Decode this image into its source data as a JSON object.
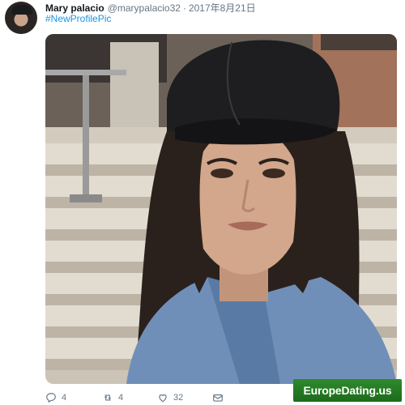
{
  "tweet": {
    "display_name": "Mary palacio",
    "handle": "@marypalacio32",
    "separator": "·",
    "date": "2017年8月21日",
    "hashtag": "#NewProfilePic"
  },
  "actions": {
    "reply_count": "4",
    "retweet_count": "4",
    "like_count": "32"
  },
  "icons": {
    "reply": "reply-icon",
    "retweet": "retweet-icon",
    "like": "heart-icon",
    "message": "envelope-icon"
  },
  "watermark": {
    "text": "EuropeDating.us"
  },
  "colors": {
    "link": "#1b95e0",
    "secondary_text": "#657786",
    "watermark_bg": "#2e8a2c"
  }
}
